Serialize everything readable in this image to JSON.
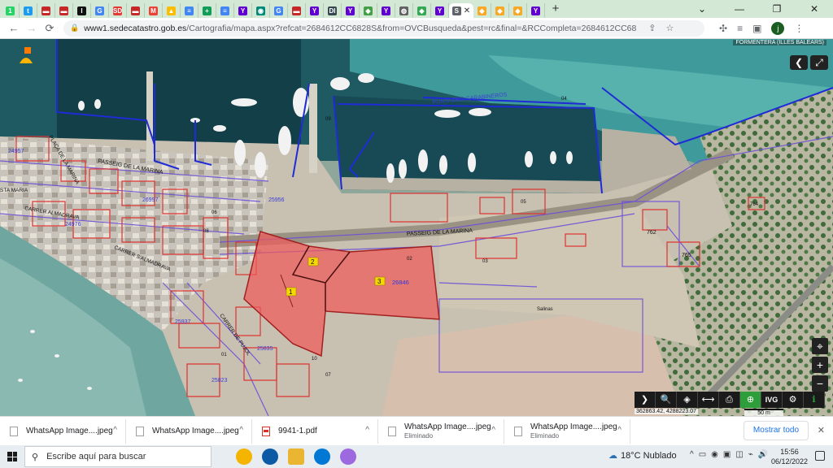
{
  "browser": {
    "tabs": [
      {
        "icon": "whatsapp-icon",
        "color": "#25d366",
        "glyph": "1"
      },
      {
        "icon": "twitter-icon",
        "color": "#1d9bf0",
        "glyph": "t"
      },
      {
        "icon": "page-icon-red",
        "color": "#c62828",
        "glyph": "▬"
      },
      {
        "icon": "page-icon-red",
        "color": "#c62828",
        "glyph": "▬"
      },
      {
        "icon": "i-icon",
        "color": "#111111",
        "glyph": "I"
      },
      {
        "icon": "translate-icon",
        "color": "#4285f4",
        "glyph": "G"
      },
      {
        "icon": "sd-icon",
        "color": "#e53935",
        "glyph": "SD"
      },
      {
        "icon": "page-icon-red",
        "color": "#c62828",
        "glyph": "▬"
      },
      {
        "icon": "gmail-icon",
        "color": "#ea4335",
        "glyph": "M"
      },
      {
        "icon": "drive-icon",
        "color": "#fbbc04",
        "glyph": "▲"
      },
      {
        "icon": "docs-icon",
        "color": "#4285f4",
        "glyph": "≡"
      },
      {
        "icon": "sheets-icon",
        "color": "#0f9d58",
        "glyph": "+"
      },
      {
        "icon": "docs-icon",
        "color": "#4285f4",
        "glyph": "≡"
      },
      {
        "icon": "yahoo-icon",
        "color": "#6001d2",
        "glyph": "Y"
      },
      {
        "icon": "circle-icon",
        "color": "#00897b",
        "glyph": "◉"
      },
      {
        "icon": "google-icon",
        "color": "#4285f4",
        "glyph": "G"
      },
      {
        "icon": "page-icon-red",
        "color": "#c62828",
        "glyph": "▬"
      },
      {
        "icon": "yahoo-icon",
        "color": "#6001d2",
        "glyph": "Y"
      },
      {
        "icon": "di-icon",
        "color": "#37474f",
        "glyph": "DI"
      },
      {
        "icon": "yahoo-icon",
        "color": "#6001d2",
        "glyph": "Y"
      },
      {
        "icon": "shield-icon",
        "color": "#43a047",
        "glyph": "◆"
      },
      {
        "icon": "yahoo-icon",
        "color": "#6001d2",
        "glyph": "Y"
      },
      {
        "icon": "globe-icon",
        "color": "#616161",
        "glyph": "◍"
      },
      {
        "icon": "maps-icon",
        "color": "#34a853",
        "glyph": "◆"
      },
      {
        "icon": "yahoo-icon",
        "color": "#6001d2",
        "glyph": "Y"
      }
    ],
    "active_tab": {
      "glyph": "S",
      "color": "#5f6368",
      "close": "✕"
    },
    "tabs_after": [
      {
        "icon": "catastro-icon",
        "color": "#f9a825",
        "glyph": "◆"
      },
      {
        "icon": "catastro-icon",
        "color": "#f9a825",
        "glyph": "◆"
      },
      {
        "icon": "catastro-icon",
        "color": "#f9a825",
        "glyph": "◆"
      },
      {
        "icon": "yahoo-icon",
        "color": "#6001d2",
        "glyph": "Y"
      }
    ],
    "new_tab": "+",
    "window_controls": {
      "tab_search": "⌄",
      "minimize": "—",
      "maximize": "❐",
      "close": "✕"
    },
    "nav": {
      "back": "←",
      "forward": "→",
      "reload": "⟳"
    },
    "url_domain": "www1.sedecatastro.gob.es",
    "url_rest": "/Cartografia/mapa.aspx?refcat=2684612CC6828S&from=OVCBusqueda&pest=rc&final=&RCCompleta=2684612CC6828S0001HG&ZV=NO&ZR=NO&an...",
    "omni_icons": {
      "share": "⇪",
      "star": "☆"
    },
    "ext_icons": {
      "puzzle": "✣",
      "list": "≡",
      "sidebar": "▣"
    },
    "profile_initial": "j",
    "menu": "⋮"
  },
  "map": {
    "top_label": "FORMENTERA (ILLES BALEARS)",
    "controls": {
      "back": "❮",
      "fullscreen": "⤢"
    },
    "zoom": {
      "locate": "⌖",
      "in": "+",
      "out": "−"
    },
    "toolbar": [
      "❯",
      "🔍",
      "◈",
      "⟷",
      "⎙",
      "⊕",
      "IVG",
      "⚙",
      "ℹ"
    ],
    "coords": "362863.42, 4288223.07",
    "scale": "50 m",
    "labels": {
      "punta": "PUNTA DES CARABINEROS",
      "passeig_top": "PASSEIG DE LA MARINA",
      "passeig_bottom": "PASSEIG DE LA MARINA",
      "carrer_almadrava": "CARRER S'ALMADRAVA",
      "carrer_side": "CARRER ALMADRAVA",
      "plaza": "PLAÇA DE LA MARINA",
      "sta_maria": "STA MARIA",
      "carrer_pujol": "CARRER DE PUJOL",
      "parcel_num": "26846",
      "parcel_1": "1",
      "parcel_2": "2",
      "parcel_3": "3",
      "p762": "762",
      "p765": "765",
      "p764": "764",
      "p05": "05",
      "p06": "06",
      "p02": "02",
      "p01": "01",
      "p03": "03",
      "p04": "04",
      "p10": "10",
      "p07": "07",
      "p08": "08",
      "p09": "09",
      "p2595": "25956",
      "p2593": "25937",
      "p2583": "25835",
      "p2582": "25823",
      "p2497": "24957",
      "p2498": "24976",
      "p2499": "26997",
      "salinas": "Salinas",
      "fill1": "FOMENTERA"
    }
  },
  "downloads": {
    "items": [
      {
        "name": "WhatsApp Image....jpeg",
        "status": "",
        "type": "image"
      },
      {
        "name": "WhatsApp Image....jpeg",
        "status": "",
        "type": "image"
      },
      {
        "name": "9941-1.pdf",
        "status": "",
        "type": "pdf"
      },
      {
        "name": "WhatsApp Image....jpeg",
        "status": "Eliminado",
        "type": "image"
      },
      {
        "name": "WhatsApp Image....jpeg",
        "status": "Eliminado",
        "type": "image"
      }
    ],
    "chevron": "^",
    "show_all": "Mostrar todo",
    "close": "✕"
  },
  "taskbar": {
    "search_placeholder": "Escribe aquí para buscar",
    "search_icon": "⚲",
    "apps": [
      {
        "icon": "chrome-icon",
        "color": "#f4b400"
      },
      {
        "icon": "edge-icon",
        "color": "#0c59a4"
      },
      {
        "icon": "explorer-icon",
        "color": "#eab530"
      },
      {
        "icon": "edge-legacy-icon",
        "color": "#0078d4"
      },
      {
        "icon": "paint-icon",
        "color": "#9c6ade"
      }
    ],
    "weather": "18°C  Nublado",
    "weather_icon": "☁",
    "tray": [
      "^",
      "▭",
      "◉",
      "▣",
      "◫",
      "⌁",
      "🔊"
    ],
    "time": "15:56",
    "date": "06/12/2022"
  }
}
